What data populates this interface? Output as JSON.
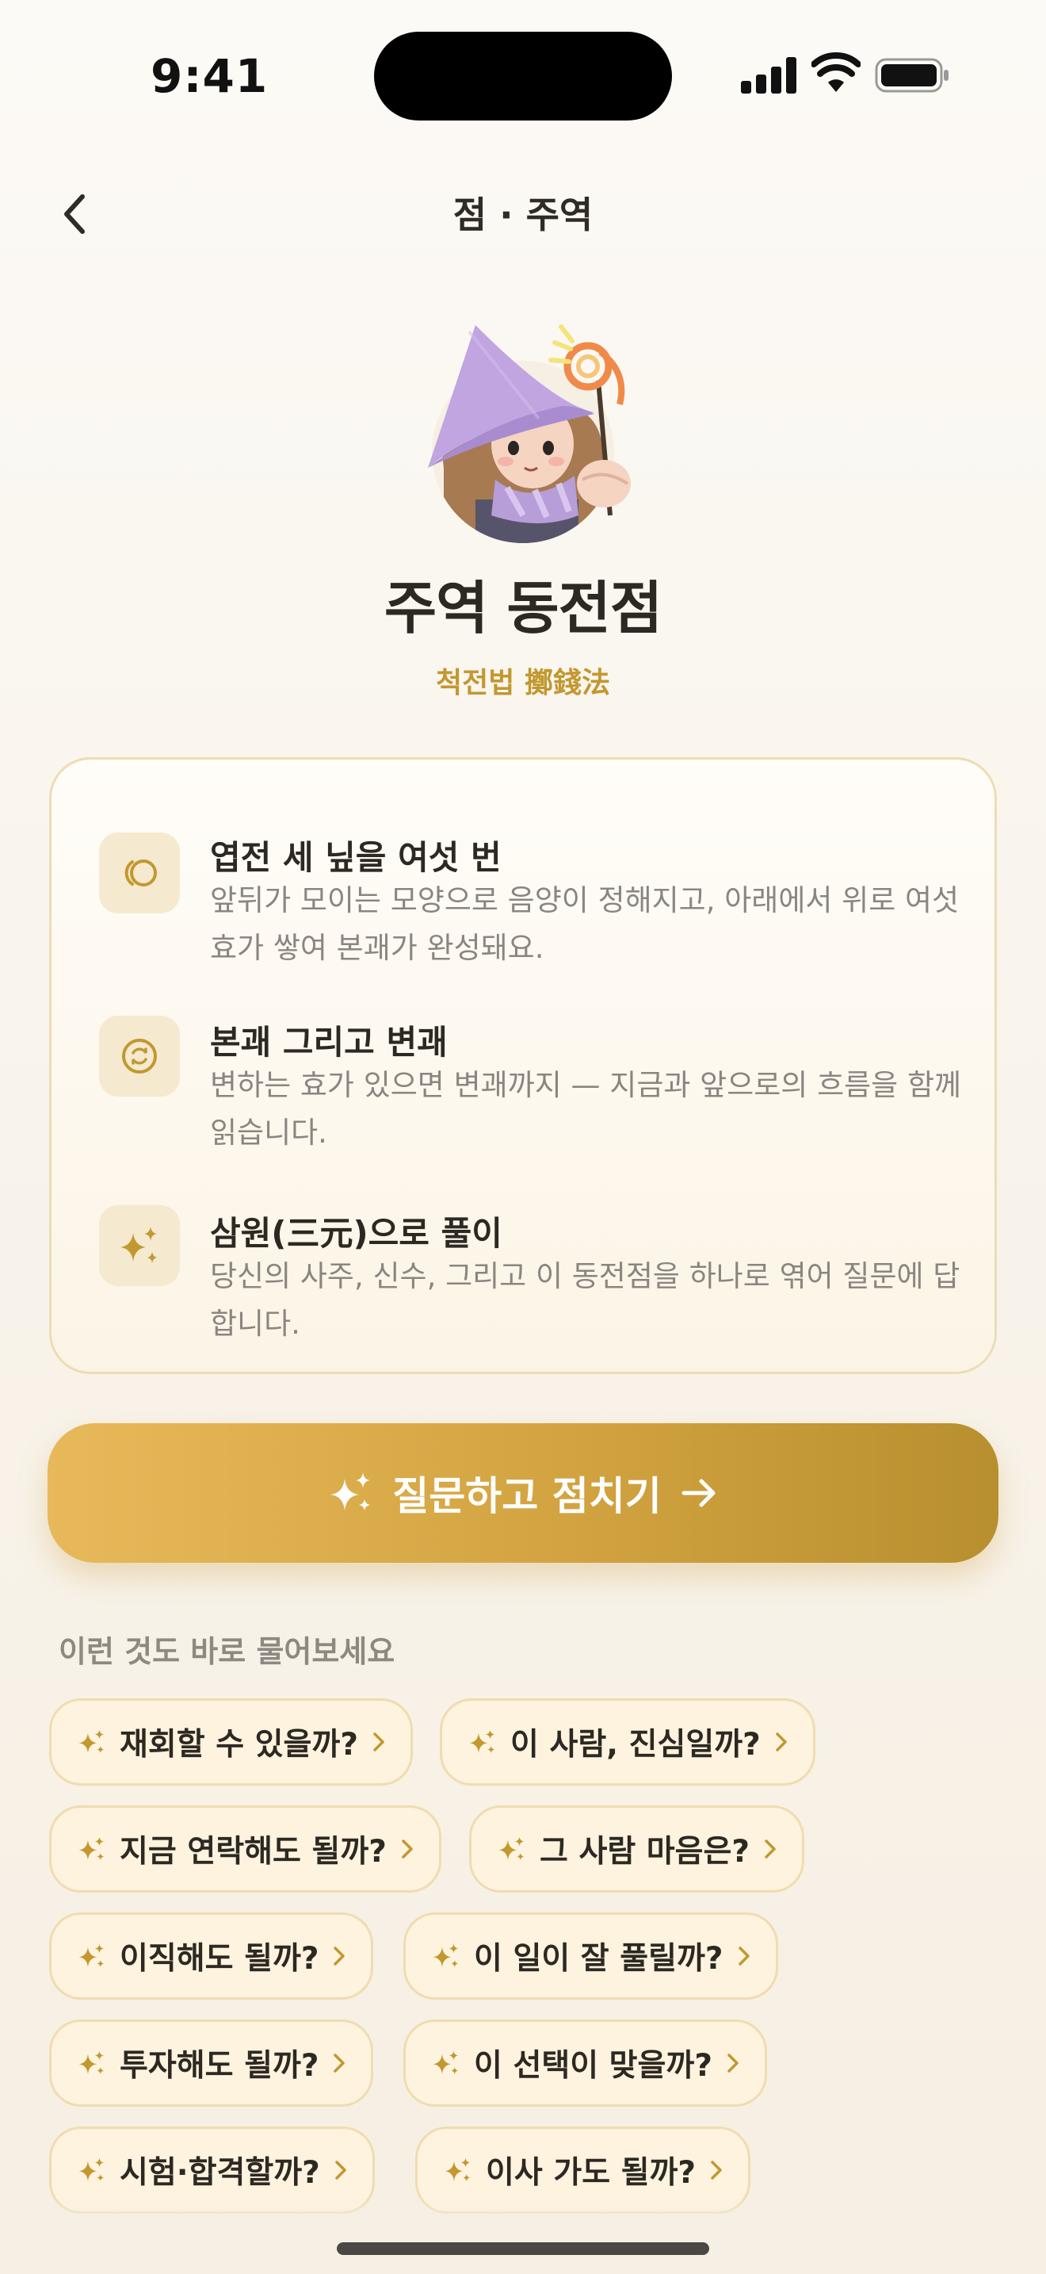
{
  "status_bar": {
    "time": "9:41"
  },
  "nav": {
    "title": "점 · 주역"
  },
  "hero": {
    "title": "주역 동전점",
    "subtitle": "척전법 擲錢法"
  },
  "features": [
    {
      "icon": "coins-icon",
      "title": "엽전 세 닢을 여섯 번",
      "desc": "앞뒤가 모이는 모양으로 음양이 정해지고, 아래에서 위로 여섯 효가 쌓여 본괘가 완성돼요."
    },
    {
      "icon": "cycle-icon",
      "title": "본괘 그리고 변괘",
      "desc": "변하는 효가 있으면 변괘까지 — 지금과 앞으로의 흐름을 함께 읽습니다."
    },
    {
      "icon": "sparkle-icon",
      "title": "삼원(三元)으로 풀이",
      "desc": "당신의 사주, 신수, 그리고 이 동전점을 하나로 엮어 질문에 답합니다."
    }
  ],
  "cta": {
    "label": "질문하고 점치기"
  },
  "suggestions": {
    "heading": "이런 것도 바로 물어보세요",
    "chips": [
      "재회할 수 있을까?",
      "이 사람, 진심일까?",
      "지금 연락해도 될까?",
      "그 사람 마음은?",
      "이직해도 될까?",
      "이 일이 잘 풀릴까?",
      "투자해도 될까?",
      "이 선택이 맞을까?",
      "시험·합격할까?",
      "이사 가도 될까?"
    ]
  },
  "colors": {
    "accent": "#c2982f",
    "cta_start": "#e7b95a",
    "cta_end": "#b88f2f",
    "chip_bg": "#fdf3df"
  }
}
